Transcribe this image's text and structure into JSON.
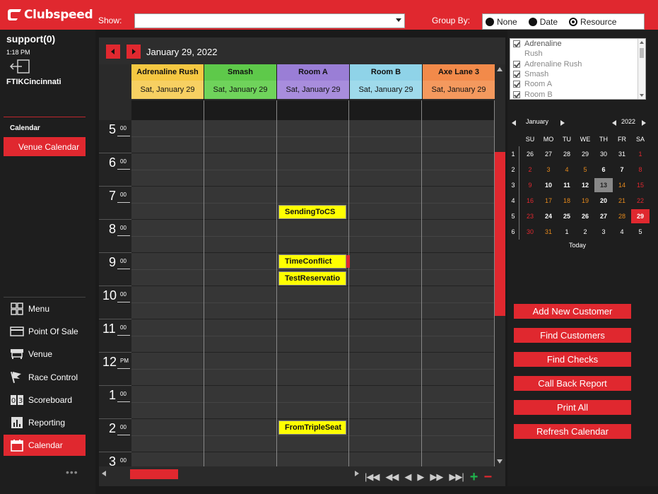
{
  "brand": {
    "name": "Clubspeed",
    "accent": "#e0282f"
  },
  "header": {
    "show_label": "Show:",
    "show_value": "",
    "group_by_label": "Group By:",
    "group_by_options": [
      "None",
      "Date",
      "Resource"
    ],
    "group_by_selected": "Resource"
  },
  "session": {
    "user": "support(0)",
    "time": "1:18 PM",
    "location": "FTIKCincinnati"
  },
  "sidebar": {
    "section_label": "Calendar",
    "sub_item": "Venue Calendar",
    "nav": [
      {
        "label": "Menu",
        "icon": "menu-grid-icon"
      },
      {
        "label": "Point Of Sale",
        "icon": "credit-card-icon"
      },
      {
        "label": "Venue",
        "icon": "venue-icon"
      },
      {
        "label": "Race Control",
        "icon": "flag-icon"
      },
      {
        "label": "Scoreboard",
        "icon": "scoreboard-icon"
      },
      {
        "label": "Reporting",
        "icon": "chart-icon"
      },
      {
        "label": "Calendar",
        "icon": "calendar-icon"
      }
    ],
    "more": "•••"
  },
  "calendar": {
    "date_title": "January 29, 2022",
    "columns": [
      {
        "name": "Adrenaline Rush",
        "day": "Sat, January 29",
        "color": "#f5c842"
      },
      {
        "name": "Smash",
        "day": "Sat, January 29",
        "color": "#5ec94a"
      },
      {
        "name": "Room A",
        "day": "Sat, January 29",
        "color": "#9a7ed6"
      },
      {
        "name": "Room B",
        "day": "Sat, January 29",
        "color": "#8fd3e8"
      },
      {
        "name": "Axe Lane 3",
        "day": "Sat, January 29",
        "color": "#f28a4a"
      }
    ],
    "hours": [
      {
        "h": "5",
        "m": "00"
      },
      {
        "h": "6",
        "m": "00"
      },
      {
        "h": "7",
        "m": "00"
      },
      {
        "h": "8",
        "m": "00"
      },
      {
        "h": "9",
        "m": "00"
      },
      {
        "h": "10",
        "m": "00"
      },
      {
        "h": "11",
        "m": "00"
      },
      {
        "h": "12",
        "m": "PM"
      },
      {
        "h": "1",
        "m": "00"
      },
      {
        "h": "2",
        "m": "00"
      },
      {
        "h": "3",
        "m": "00"
      }
    ],
    "events": [
      {
        "title": "SendingToCS",
        "column": "Room A",
        "start": "7:30"
      },
      {
        "title": "TimeConflict",
        "column": "Room A",
        "start": "9:00"
      },
      {
        "title": "TestReservatio",
        "column": "Room A",
        "start": "9:30"
      },
      {
        "title": "FromTripleSeat",
        "column": "Room A",
        "start": "2:00"
      }
    ]
  },
  "resources": [
    "Adrenaline",
    "Rush",
    "Adrenaline Rush",
    "Smash",
    "Room A",
    "Room B"
  ],
  "minical": {
    "month": "January",
    "year": "2022",
    "dow": [
      "SU",
      "MO",
      "TU",
      "WE",
      "TH",
      "FR",
      "SA"
    ],
    "weeks": [
      {
        "wk": "1",
        "days": [
          "26",
          "27",
          "28",
          "29",
          "30",
          "31",
          "1"
        ]
      },
      {
        "wk": "2",
        "days": [
          "2",
          "3",
          "4",
          "5",
          "6",
          "7",
          "8"
        ]
      },
      {
        "wk": "3",
        "days": [
          "9",
          "10",
          "11",
          "12",
          "13",
          "14",
          "15"
        ]
      },
      {
        "wk": "4",
        "days": [
          "16",
          "17",
          "18",
          "19",
          "20",
          "21",
          "22"
        ]
      },
      {
        "wk": "5",
        "days": [
          "23",
          "24",
          "25",
          "26",
          "27",
          "28",
          "29"
        ]
      },
      {
        "wk": "6",
        "days": [
          "30",
          "31",
          "1",
          "2",
          "3",
          "4",
          "5"
        ]
      }
    ],
    "today_label": "Today"
  },
  "actions": [
    "Add New Customer",
    "Find Customers",
    "Find Checks",
    "Call Back Report",
    "Print All",
    "Refresh Calendar"
  ]
}
